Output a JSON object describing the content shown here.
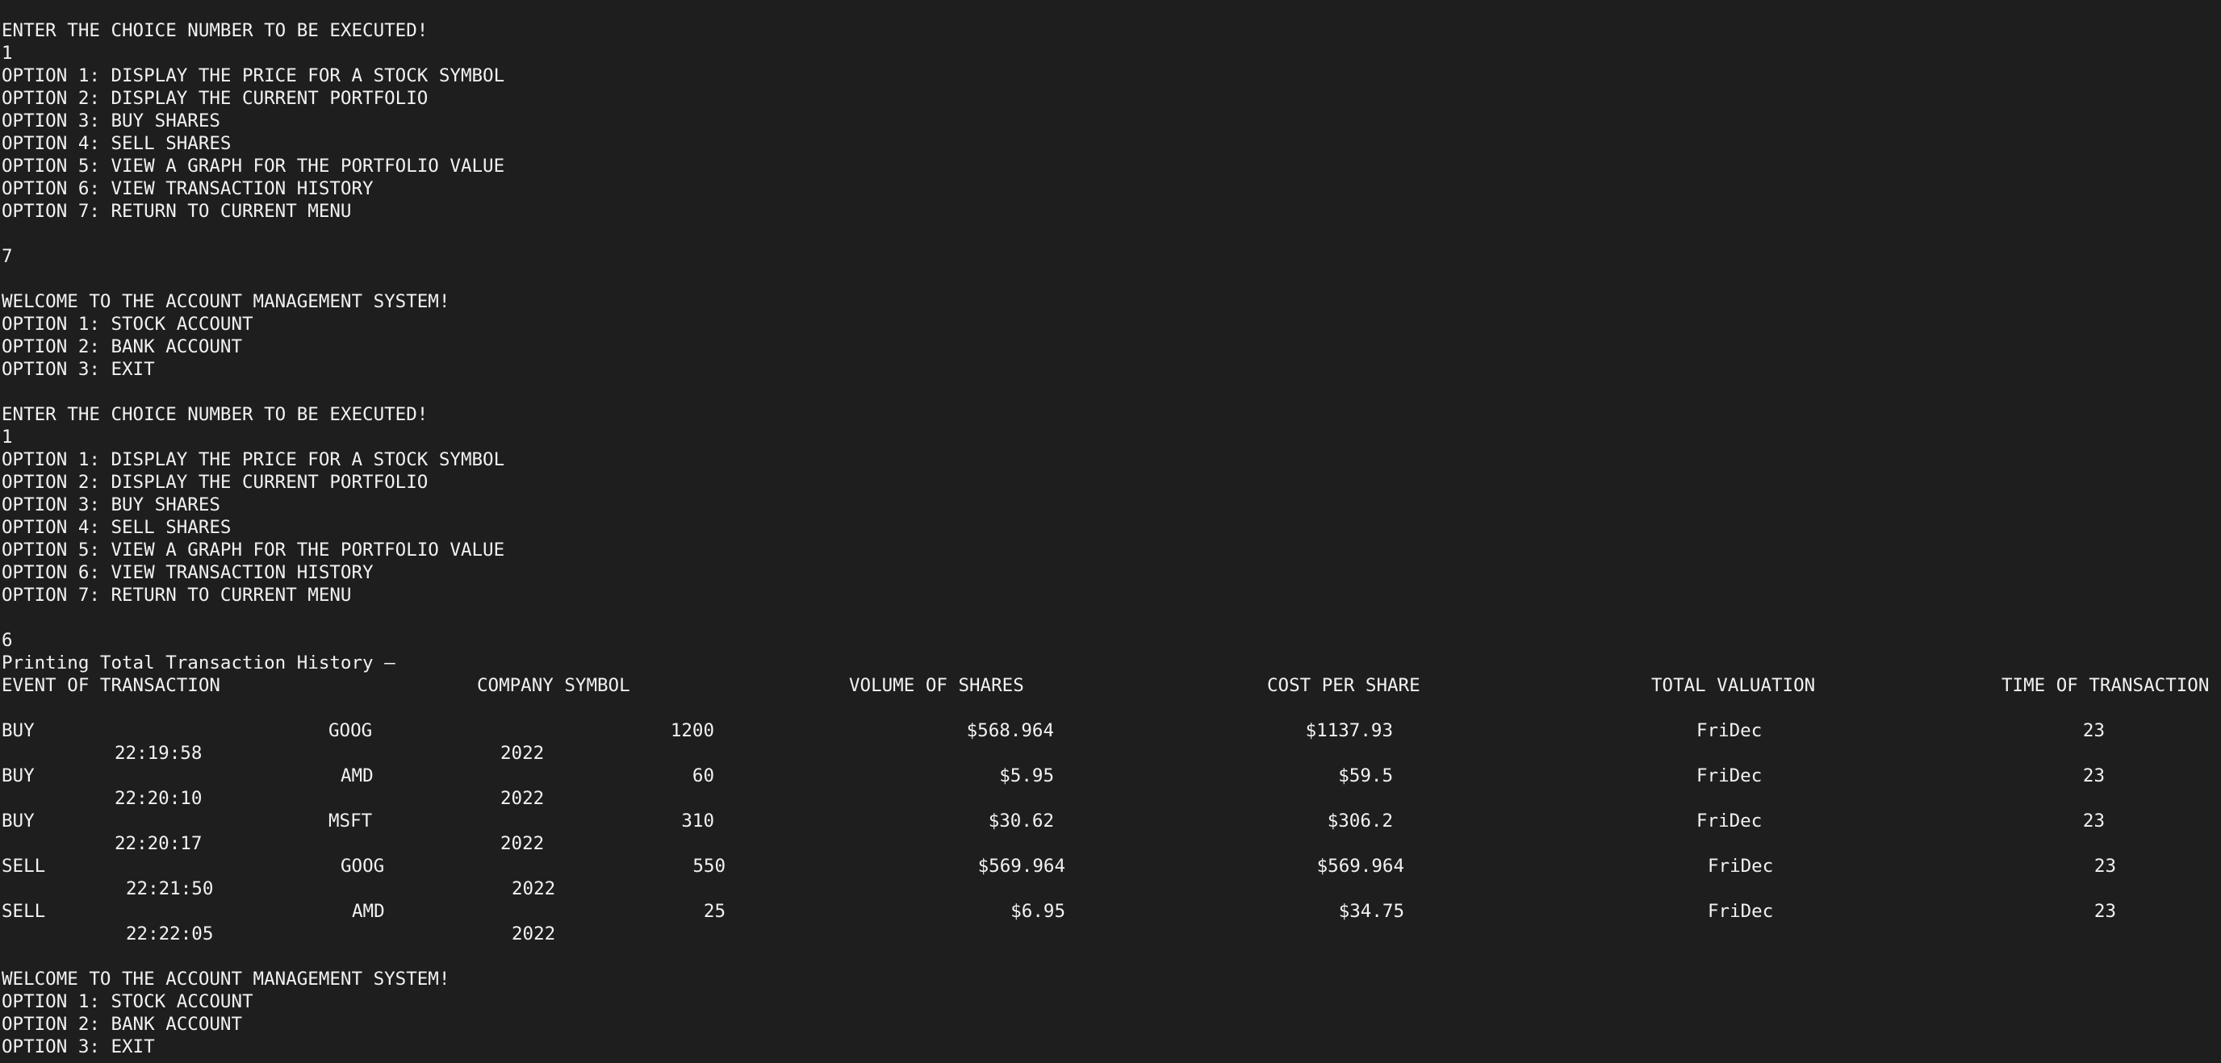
{
  "terminal": {
    "theme": {
      "background": "#1e1e1e",
      "foreground": "#f2f2f2"
    },
    "prompt_choice": "ENTER THE CHOICE NUMBER TO BE EXECUTED!",
    "stock_menu": [
      "OPTION 1: DISPLAY THE PRICE FOR A STOCK SYMBOL",
      "OPTION 2: DISPLAY THE CURRENT PORTFOLIO",
      "OPTION 3: BUY SHARES",
      "OPTION 4: SELL SHARES",
      "OPTION 5: VIEW A GRAPH FOR THE PORTFOLIO VALUE",
      "OPTION 6: VIEW TRANSACTION HISTORY",
      "OPTION 7: RETURN TO CURRENT MENU"
    ],
    "main_welcome": "WELCOME TO THE ACCOUNT MANAGEMENT SYSTEM!",
    "main_menu": [
      "OPTION 1: STOCK ACCOUNT",
      "OPTION 2: BANK ACCOUNT",
      "OPTION 3: EXIT"
    ],
    "inputs": {
      "first_choice": "1",
      "second_choice": "7",
      "third_choice": "1",
      "fourth_choice": "6"
    },
    "history_heading": "Printing Total Transaction History —",
    "history_columns": [
      "EVENT OF TRANSACTION",
      "COMPANY SYMBOL",
      "VOLUME OF SHARES",
      "COST PER SHARE",
      "TOTAL VALUATION",
      "TIME OF TRANSACTION"
    ],
    "transactions": [
      {
        "event": "BUY",
        "symbol": "GOOG",
        "volume": "1200",
        "cost": "$568.964",
        "total": "$1137.93",
        "day": "FriDec",
        "date": "23",
        "time": "22:19:58",
        "year": "2022"
      },
      {
        "event": "BUY",
        "symbol": "AMD",
        "volume": "60",
        "cost": "$5.95",
        "total": "$59.5",
        "day": "FriDec",
        "date": "23",
        "time": "22:20:10",
        "year": "2022"
      },
      {
        "event": "BUY",
        "symbol": "MSFT",
        "volume": "310",
        "cost": "$30.62",
        "total": "$306.2",
        "day": "FriDec",
        "date": "23",
        "time": "22:20:17",
        "year": "2022"
      },
      {
        "event": "SELL",
        "symbol": "GOOG",
        "volume": "550",
        "cost": "$569.964",
        "total": "$569.964",
        "day": "FriDec",
        "date": "23",
        "time": "22:21:50",
        "year": "2022"
      },
      {
        "event": "SELL",
        "symbol": "AMD",
        "volume": "25",
        "cost": "$6.95",
        "total": "$34.75",
        "day": "FriDec",
        "date": "23",
        "time": "22:22:05",
        "year": "2022"
      }
    ]
  }
}
